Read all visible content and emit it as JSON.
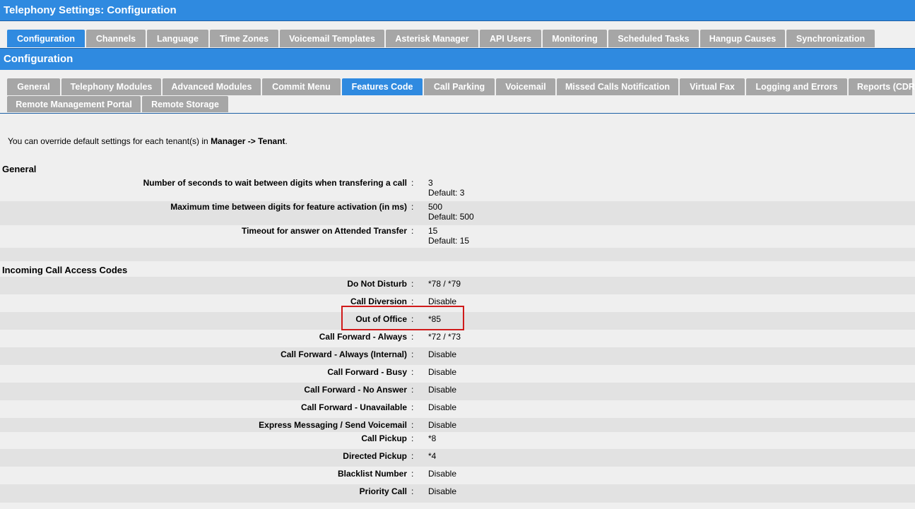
{
  "window": {
    "title": "Telephony Settings:  Configuration"
  },
  "main_tabs": [
    {
      "label": "Configuration",
      "active": true
    },
    {
      "label": "Channels"
    },
    {
      "label": "Language"
    },
    {
      "label": "Time Zones"
    },
    {
      "label": "Voicemail Templates"
    },
    {
      "label": "Asterisk Manager"
    },
    {
      "label": "API Users"
    },
    {
      "label": "Monitoring"
    },
    {
      "label": "Scheduled Tasks"
    },
    {
      "label": "Hangup Causes"
    },
    {
      "label": "Synchronization"
    }
  ],
  "section_title": "Configuration",
  "sub_tabs_row1": [
    {
      "label": "General"
    },
    {
      "label": "Telephony Modules"
    },
    {
      "label": "Advanced Modules"
    },
    {
      "label": "Commit Menu"
    },
    {
      "label": "Features Code",
      "active": true
    },
    {
      "label": "Call Parking"
    },
    {
      "label": "Voicemail"
    },
    {
      "label": "Missed Calls Notification"
    },
    {
      "label": "Virtual Fax"
    },
    {
      "label": "Logging and Errors"
    },
    {
      "label": "Reports (CDR"
    }
  ],
  "sub_tabs_row2": [
    {
      "label": "Remote Management Portal"
    },
    {
      "label": "Remote Storage"
    }
  ],
  "note": {
    "prefix": "You can override default settings for each tenant(s) in ",
    "bold": "Manager -> Tenant",
    "suffix": "."
  },
  "general": {
    "heading": "General",
    "rows": [
      {
        "label": "Number of seconds to wait between digits when transfering a call",
        "value": "3",
        "default": "Default: 3"
      },
      {
        "label": "Maximum time between digits for feature activation (in ms)",
        "value": "500",
        "default": "Default: 500"
      },
      {
        "label": "Timeout for answer on Attended Transfer",
        "value": "15",
        "default": "Default: 15"
      }
    ]
  },
  "incoming": {
    "heading": "Incoming Call Access Codes",
    "rows": [
      {
        "label": "Do Not Disturb",
        "value": "*78 / *79"
      },
      {
        "label": "Call Diversion",
        "value": "Disable"
      },
      {
        "label": "Out of Office",
        "value": "*85"
      },
      {
        "label": "Call Forward - Always",
        "value": "*72 / *73"
      },
      {
        "label": "Call Forward - Always (Internal)",
        "value": "Disable"
      },
      {
        "label": "Call Forward - Busy",
        "value": "Disable"
      },
      {
        "label": "Call Forward - No Answer",
        "value": "Disable"
      },
      {
        "label": "Call Forward - Unavailable",
        "value": "Disable"
      },
      {
        "label": "Express Messaging / Send Voicemail",
        "value": "Disable"
      },
      {
        "label": "Call Pickup",
        "value": "*8"
      },
      {
        "label": "Directed Pickup",
        "value": "*4"
      },
      {
        "label": "Blacklist Number",
        "value": "Disable"
      },
      {
        "label": "Priority Call",
        "value": "Disable"
      }
    ]
  },
  "colon": ":",
  "colors": {
    "accent": "#2f8ae0",
    "tab_inactive": "#a6a6a6",
    "highlight": "#d01a1a"
  }
}
